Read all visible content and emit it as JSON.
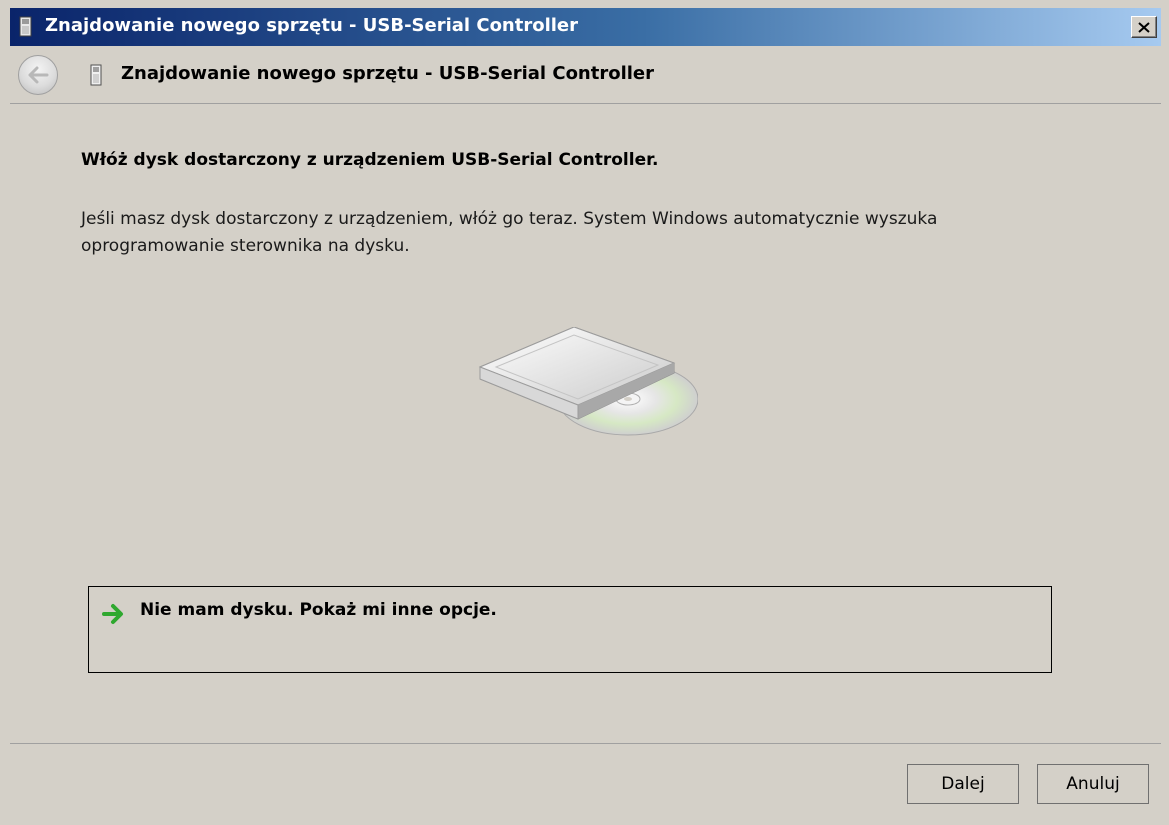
{
  "window": {
    "title": "Znajdowanie nowego sprzętu - USB-Serial Controller"
  },
  "header": {
    "title": "Znajdowanie nowego sprzętu - USB-Serial Controller",
    "back_icon": "back-arrow-icon",
    "device_icon": "usb-device-icon"
  },
  "content": {
    "instruction": "Włóż dysk dostarczony z urządzeniem USB-Serial Controller.",
    "description": "Jeśli masz dysk dostarczony z urządzeniem, włóż go teraz. System Windows automatycznie wyszuka oprogramowanie sterownika na dysku.",
    "illustration_icon": "disc-drive-icon",
    "option": {
      "label": "Nie mam dysku. Pokaż mi inne opcje.",
      "icon": "green-arrow-icon"
    }
  },
  "buttons": {
    "next": "Dalej",
    "cancel": "Anuluj"
  },
  "colors": {
    "title_gradient_start": "#0a246a",
    "title_gradient_end": "#a6caf0",
    "dialog_background": "#d4d0c8",
    "arrow_green": "#2fa82f"
  }
}
